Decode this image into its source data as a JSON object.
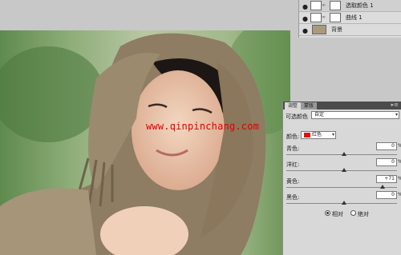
{
  "layers": [
    {
      "name": "选取颜色 1",
      "selected": true
    },
    {
      "name": "曲线 1",
      "selected": false
    },
    {
      "name": "背景",
      "selected": false
    }
  ],
  "watermark": "www.qinpinchang.com",
  "adjust": {
    "tabs": [
      "调整",
      "蒙版"
    ],
    "title": "可选颜色",
    "preset_value": "自定",
    "color_label": "颜色:",
    "color_value": "红色",
    "sliders": [
      {
        "label": "青色:",
        "value": "0",
        "pos": 0.5
      },
      {
        "label": "洋红:",
        "value": "0",
        "pos": 0.5
      },
      {
        "label": "黄色:",
        "value": "+71",
        "pos": 0.85
      },
      {
        "label": "黑色:",
        "value": "0",
        "pos": 0.5
      }
    ],
    "pct": "%",
    "radio_relative": "相对",
    "radio_absolute": "绝对"
  },
  "colors": {
    "accent_red": "#e01010",
    "watermark_red": "#e00000"
  }
}
